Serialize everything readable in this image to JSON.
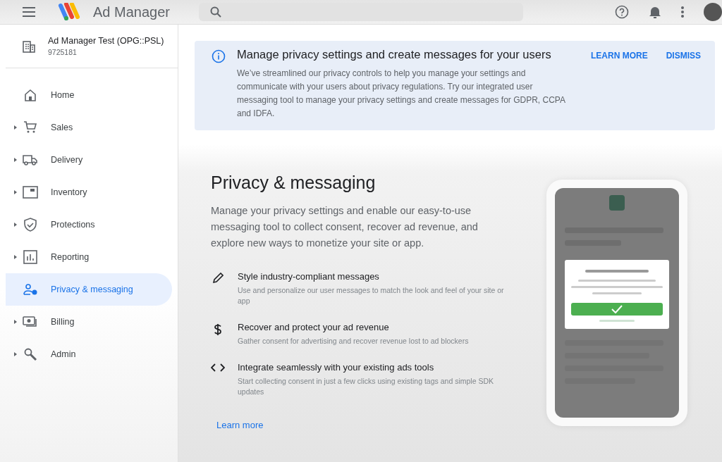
{
  "app_bar": {
    "title": "Ad Manager"
  },
  "account": {
    "name": "Ad Manager Test (OPG::PSL)",
    "id": "9725181"
  },
  "nav": [
    {
      "label": "Home",
      "expandable": false,
      "selected": false
    },
    {
      "label": "Sales",
      "expandable": true,
      "selected": false
    },
    {
      "label": "Delivery",
      "expandable": true,
      "selected": false
    },
    {
      "label": "Inventory",
      "expandable": true,
      "selected": false
    },
    {
      "label": "Protections",
      "expandable": true,
      "selected": false
    },
    {
      "label": "Reporting",
      "expandable": true,
      "selected": false
    },
    {
      "label": "Privacy & messaging",
      "expandable": false,
      "selected": true
    },
    {
      "label": "Billing",
      "expandable": true,
      "selected": false
    },
    {
      "label": "Admin",
      "expandable": true,
      "selected": false
    }
  ],
  "banner": {
    "title": "Manage privacy settings and create messages for your users",
    "body": "We’ve streamlined our privacy controls to help you manage your settings and communicate with your users about privacy regulations. Try our integrated user messaging tool to manage your privacy settings and create messages for GDPR, CCPA and IDFA.",
    "actions": [
      "LEARN MORE",
      "DISMISS"
    ]
  },
  "page": {
    "title": "Privacy & messaging",
    "description": "Manage your privacy settings and enable our easy-to-use messaging tool to collect consent, recover ad revenue, and explore new ways to monetize your site or app.",
    "features": [
      {
        "title": "Style industry-compliant messages",
        "text": "Use and personalize our user messages to match the look and feel of your site or app"
      },
      {
        "title": "Recover and protect your ad revenue",
        "text": "Gather consent for advertising and recover revenue lost to ad blockers"
      },
      {
        "title": "Integrate seamlessly with your existing ads tools",
        "text": "Start collecting consent in just a few clicks using existing tags and simple SDK updates"
      }
    ],
    "link": "Learn more"
  }
}
